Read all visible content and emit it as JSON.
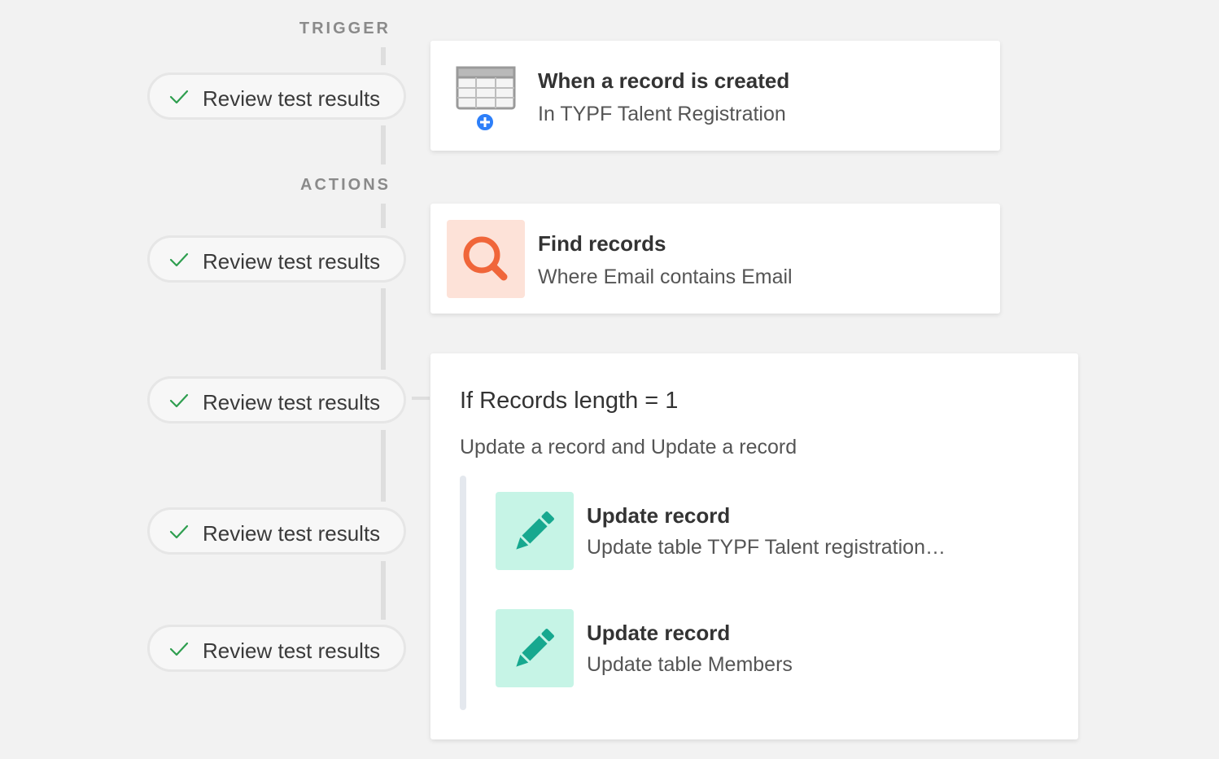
{
  "sections": {
    "trigger": "TRIGGER",
    "actions": "ACTIONS"
  },
  "review_buttons": [
    {
      "label": "Review test results"
    },
    {
      "label": "Review test results"
    },
    {
      "label": "Review test results"
    },
    {
      "label": "Review test results"
    },
    {
      "label": "Review test results"
    }
  ],
  "trigger_card": {
    "title": "When a record is created",
    "subtitle": "In TYPF Talent Registration",
    "icon": "table-add-icon"
  },
  "find_card": {
    "title": "Find records",
    "subtitle": "Where Email contains Email",
    "icon": "search-icon"
  },
  "condition_card": {
    "title": "If Records length = 1",
    "subtitle": "Update a record and Update a record",
    "steps": [
      {
        "title": "Update record",
        "subtitle": "Update table TYPF Talent registration…",
        "icon": "pencil-icon"
      },
      {
        "title": "Update record",
        "subtitle": "Update table Members",
        "icon": "pencil-icon"
      }
    ]
  },
  "colors": {
    "check": "#2e9e4f",
    "search_bg": "#fde2d8",
    "search_fg": "#f0663a",
    "pencil_bg": "#c6f4e6",
    "pencil_fg": "#17a88f",
    "plus": "#2d7ff9"
  }
}
